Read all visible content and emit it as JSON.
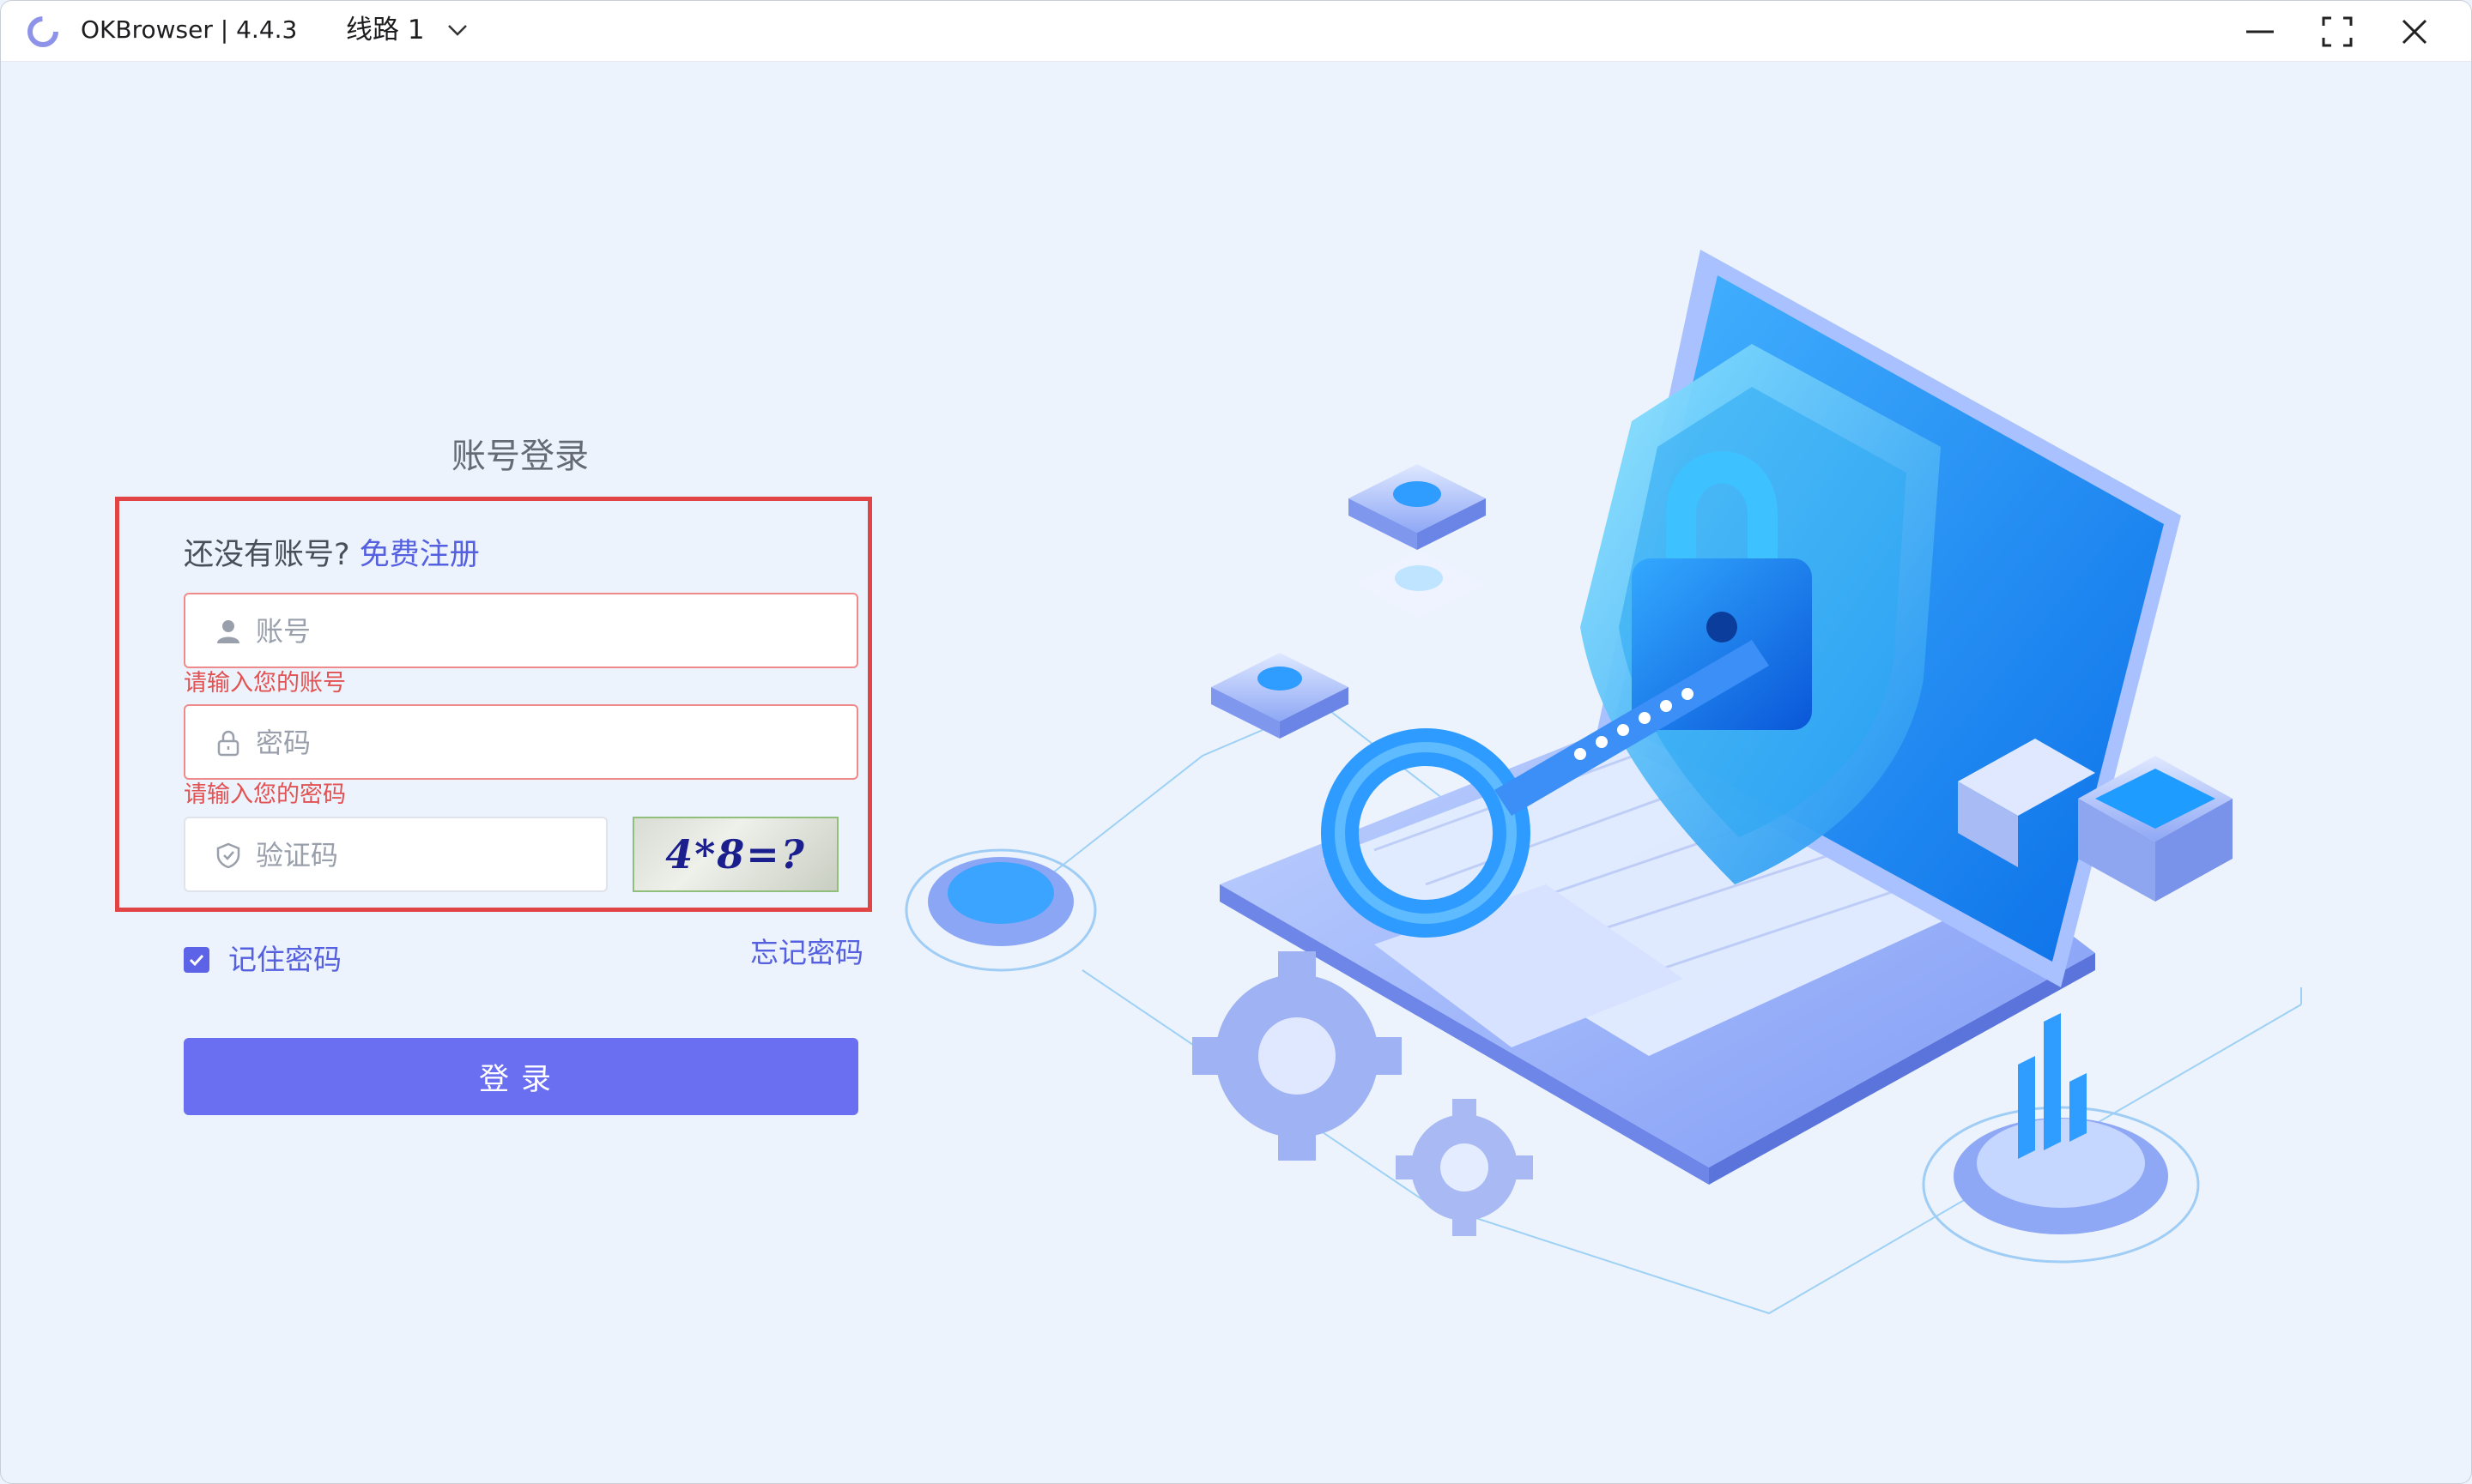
{
  "app": {
    "title": "OKBrowser | 4.4.3",
    "route_label": "线路 1",
    "colors": {
      "accent": "#5d63e6",
      "error": "#e25252",
      "highlight": "#e04444",
      "background": "#ecf3fc"
    },
    "icons": [
      "okbrowser-logo-icon",
      "chevron-down-icon",
      "minimize-icon",
      "maximize-icon",
      "close-icon"
    ]
  },
  "login": {
    "heading": "账号登录",
    "register_prompt": "还没有账号?",
    "register_link": "免费注册",
    "account": {
      "placeholder": "账号",
      "value": "",
      "error": "请输入您的账号",
      "icon": "user-icon"
    },
    "password": {
      "placeholder": "密码",
      "value": "",
      "error": "请输入您的密码",
      "icon": "lock-icon"
    },
    "captcha": {
      "placeholder": "验证码",
      "value": "",
      "icon": "shield-icon",
      "image_text": "4*8=?"
    },
    "remember_label": "记住密码",
    "remember_checked": true,
    "forgot_label": "忘记密码",
    "submit_label": "登录"
  }
}
